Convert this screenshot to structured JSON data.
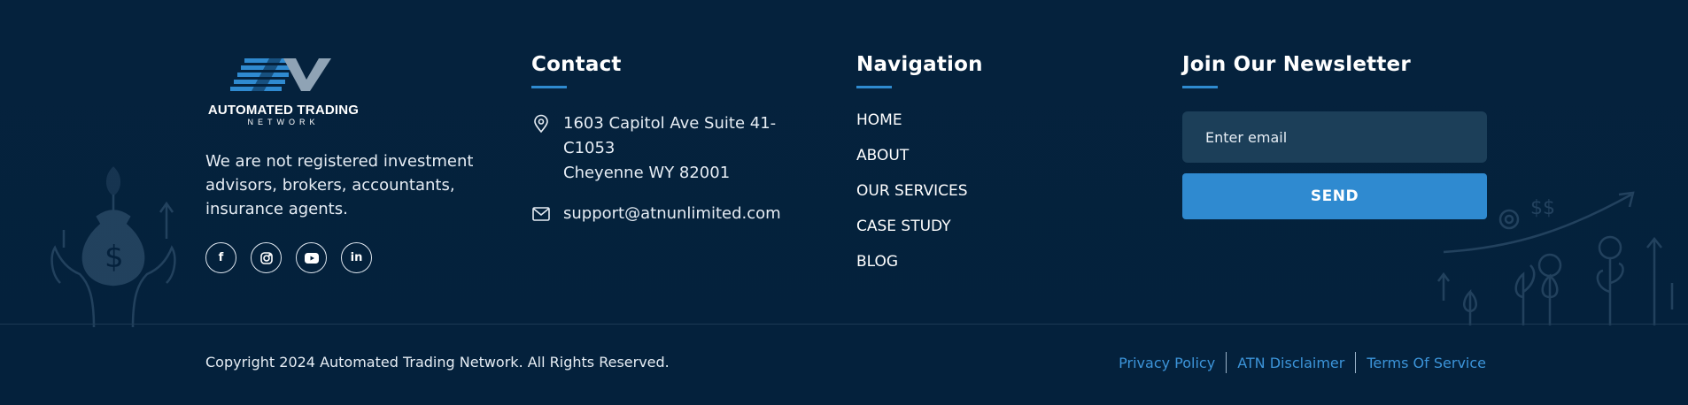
{
  "brand": {
    "wordmark": "AUTOMATED TRADING",
    "subtitle": "NETWORK",
    "description": "We are not registered investment advisors, brokers, accountants, insurance agents."
  },
  "socials": [
    {
      "icon": "facebook-icon",
      "glyph": "f"
    },
    {
      "icon": "instagram-icon",
      "glyph": ""
    },
    {
      "icon": "youtube-icon",
      "glyph": ""
    },
    {
      "icon": "linkedin-icon",
      "glyph": "in"
    }
  ],
  "contact": {
    "title": "Contact",
    "address_line1": "1603 Capitol Ave Suite 41- C1053",
    "address_line2": "Cheyenne WY 82001",
    "email": "support@atnunlimited.com"
  },
  "navigation": {
    "title": "Navigation",
    "items": [
      "HOME",
      "ABOUT",
      "OUR SERVICES",
      "CASE STUDY",
      "BLOG"
    ]
  },
  "newsletter": {
    "title": "Join Our Newsletter",
    "placeholder": "Enter email",
    "button": "SEND"
  },
  "bottom": {
    "copyright": "Copyright 2024 Automated Trading Network. All Rights Reserved.",
    "links": [
      "Privacy Policy",
      "ATN Disclaimer",
      "Terms Of Service"
    ]
  },
  "colors": {
    "background": "#04213d",
    "accent": "#2f8ad0",
    "link": "#3c94d9"
  }
}
